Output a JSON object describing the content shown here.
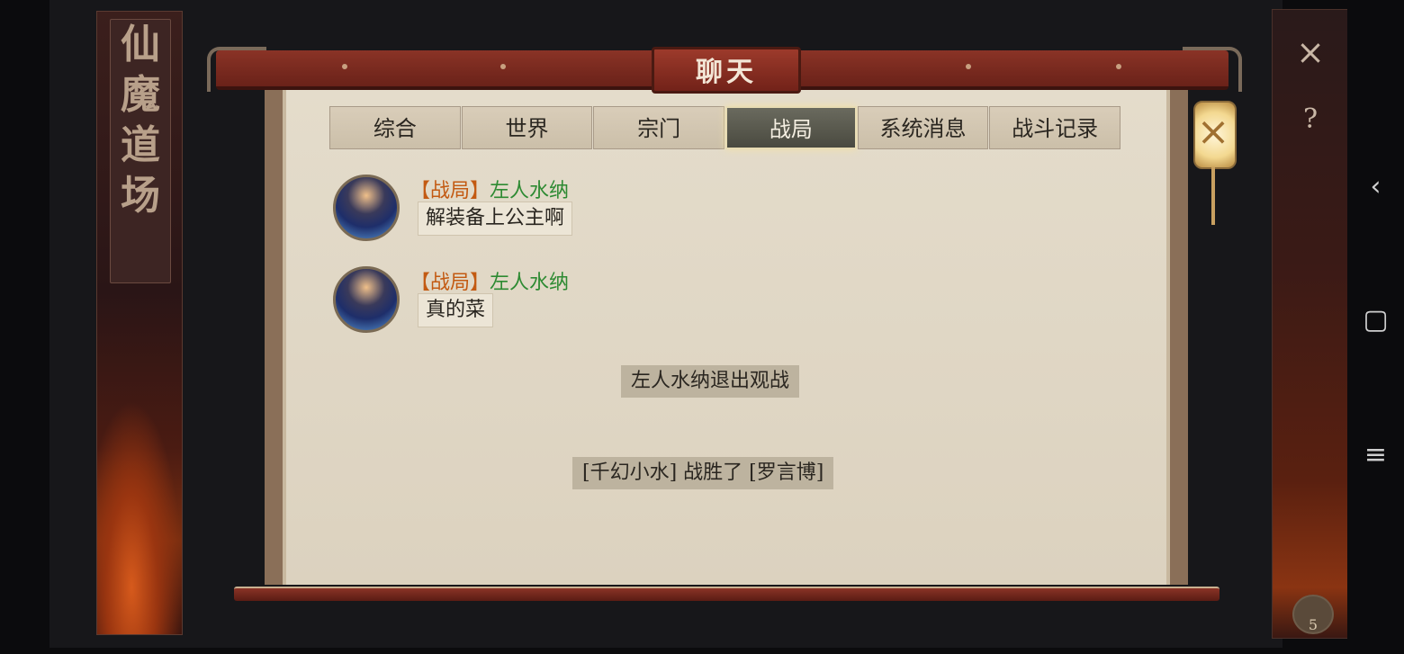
{
  "left_panel": {
    "title_chars": [
      "仙",
      "魔",
      "道",
      "场"
    ]
  },
  "dialog": {
    "title": "聊天",
    "tabs": [
      {
        "label": "综合",
        "active": false
      },
      {
        "label": "世界",
        "active": false
      },
      {
        "label": "宗门",
        "active": false
      },
      {
        "label": "战局",
        "active": true
      },
      {
        "label": "系统消息",
        "active": false
      },
      {
        "label": "战斗记录",
        "active": false
      }
    ],
    "messages": [
      {
        "tag": "【战局】",
        "username": "左人水纳",
        "text": "解装备上公主啊"
      },
      {
        "tag": "【战局】",
        "username": "左人水纳",
        "text": "真的菜"
      }
    ],
    "notices": [
      "左人水纳退出观战",
      "[千幻小水] 战胜了 [罗言博]"
    ]
  },
  "right_panel": {
    "close_icon": "×",
    "help_icon": "?",
    "badge_number": "5"
  },
  "system_nav": {
    "back_icon": "‹",
    "home_icon": "▢",
    "menu_icon": "≡"
  },
  "colors": {
    "tag": "#c35a12",
    "username": "#2d8a32",
    "title_bar": "#8a3326",
    "paper": "#dcd2bf"
  }
}
